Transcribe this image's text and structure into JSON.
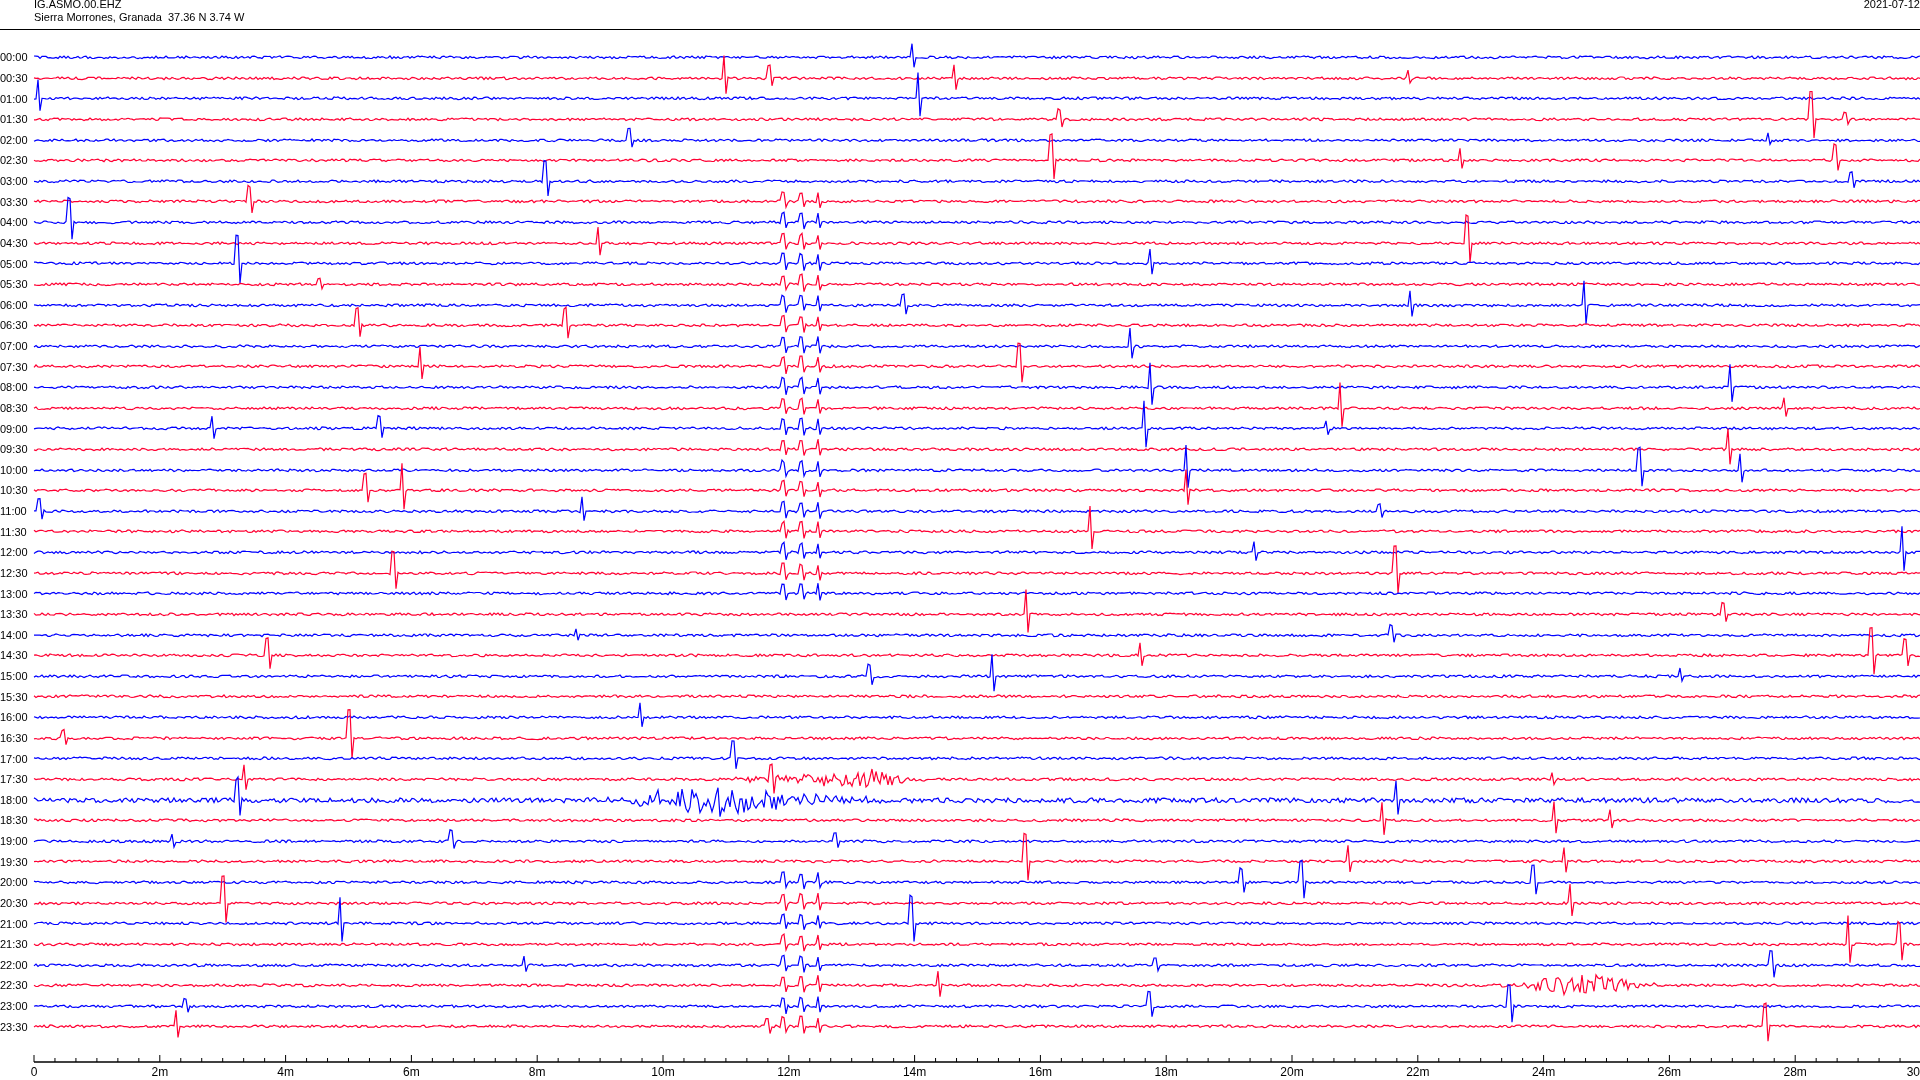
{
  "header": {
    "station": "IG.ASMO.00.EHZ",
    "location": "Sierra Morrones, Granada  37.36 N 3.74 W",
    "date": "2021-07-12"
  },
  "rows": [
    {
      "label": "00:00",
      "color": "#0000ff"
    },
    {
      "label": "00:30",
      "color": "#ff0033"
    },
    {
      "label": "01:00",
      "color": "#0000ff"
    },
    {
      "label": "01:30",
      "color": "#ff0033"
    },
    {
      "label": "02:00",
      "color": "#0000ff"
    },
    {
      "label": "02:30",
      "color": "#ff0033"
    },
    {
      "label": "03:00",
      "color": "#0000ff"
    },
    {
      "label": "03:30",
      "color": "#ff0033"
    },
    {
      "label": "04:00",
      "color": "#0000ff"
    },
    {
      "label": "04:30",
      "color": "#ff0033"
    },
    {
      "label": "05:00",
      "color": "#0000ff"
    },
    {
      "label": "05:30",
      "color": "#ff0033"
    },
    {
      "label": "06:00",
      "color": "#0000ff"
    },
    {
      "label": "06:30",
      "color": "#ff0033"
    },
    {
      "label": "07:00",
      "color": "#0000ff"
    },
    {
      "label": "07:30",
      "color": "#ff0033"
    },
    {
      "label": "08:00",
      "color": "#0000ff"
    },
    {
      "label": "08:30",
      "color": "#ff0033"
    },
    {
      "label": "09:00",
      "color": "#0000ff"
    },
    {
      "label": "09:30",
      "color": "#ff0033"
    },
    {
      "label": "10:00",
      "color": "#0000ff"
    },
    {
      "label": "10:30",
      "color": "#ff0033"
    },
    {
      "label": "11:00",
      "color": "#0000ff"
    },
    {
      "label": "11:30",
      "color": "#ff0033"
    },
    {
      "label": "12:00",
      "color": "#0000ff"
    },
    {
      "label": "12:30",
      "color": "#ff0033"
    },
    {
      "label": "13:00",
      "color": "#0000ff"
    },
    {
      "label": "13:30",
      "color": "#ff0033"
    },
    {
      "label": "14:00",
      "color": "#0000ff"
    },
    {
      "label": "14:30",
      "color": "#ff0033"
    },
    {
      "label": "15:00",
      "color": "#0000ff"
    },
    {
      "label": "15:30",
      "color": "#ff0033"
    },
    {
      "label": "16:00",
      "color": "#0000ff"
    },
    {
      "label": "16:30",
      "color": "#ff0033"
    },
    {
      "label": "17:00",
      "color": "#0000ff"
    },
    {
      "label": "17:30",
      "color": "#ff0033"
    },
    {
      "label": "18:00",
      "color": "#0000ff"
    },
    {
      "label": "18:30",
      "color": "#ff0033"
    },
    {
      "label": "19:00",
      "color": "#0000ff"
    },
    {
      "label": "19:30",
      "color": "#ff0033"
    },
    {
      "label": "20:00",
      "color": "#0000ff"
    },
    {
      "label": "20:30",
      "color": "#ff0033"
    },
    {
      "label": "21:00",
      "color": "#0000ff"
    },
    {
      "label": "21:30",
      "color": "#ff0033"
    },
    {
      "label": "22:00",
      "color": "#0000ff"
    },
    {
      "label": "22:30",
      "color": "#ff0033"
    },
    {
      "label": "23:00",
      "color": "#0000ff"
    },
    {
      "label": "23:30",
      "color": "#ff0033"
    }
  ],
  "x_axis": {
    "ticks": [
      "0",
      "2m",
      "4m",
      "6m",
      "8m",
      "10m",
      "12m",
      "14m",
      "16m",
      "18m",
      "20m",
      "22m",
      "24m",
      "26m",
      "28m",
      "30"
    ]
  }
}
